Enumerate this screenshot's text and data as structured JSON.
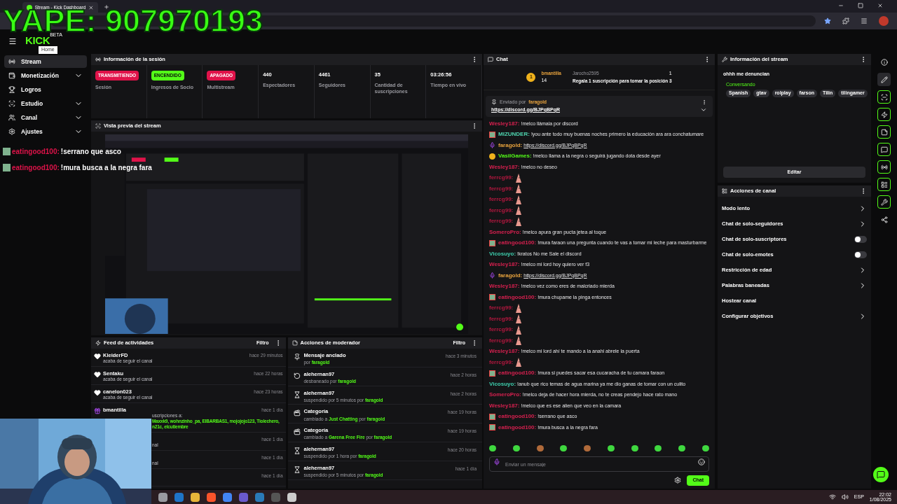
{
  "browser": {
    "tab_title": "Stream - Kick Dashboard"
  },
  "overlay": {
    "banner": "YAPE: 907970193",
    "chat_lines": [
      {
        "user": "eatingood100:",
        "text": "!serrano que asco"
      },
      {
        "user": "eatingood100:",
        "text": "!mura busca a la negra fara"
      }
    ]
  },
  "header": {
    "logo": "KICK",
    "logo_tag": "BETA",
    "tooltip": "Home"
  },
  "sidebar": {
    "items": [
      {
        "label": "Stream",
        "selected": true,
        "expandable": false
      },
      {
        "label": "Monetización",
        "selected": false,
        "expandable": true
      },
      {
        "label": "Logros",
        "selected": false,
        "expandable": false
      },
      {
        "label": "Estudio",
        "selected": false,
        "expandable": true
      },
      {
        "label": "Canal",
        "selected": false,
        "expandable": true
      },
      {
        "label": "Ajustes",
        "selected": false,
        "expandable": true
      }
    ]
  },
  "session": {
    "title": "Información de la sesión",
    "cells": [
      {
        "kind": "badge",
        "value": "TRANSMITIENDO",
        "color": "#e0134a",
        "label": "Sesión"
      },
      {
        "kind": "badge",
        "value": "ENCENDIDO",
        "color": "#53fc18",
        "label": "Ingresos de Socio"
      },
      {
        "kind": "badge",
        "value": "APAGADO",
        "color": "#e0134a",
        "label": "Multistream"
      },
      {
        "kind": "stat",
        "value": "440",
        "label": "Espectadores"
      },
      {
        "kind": "stat",
        "value": "4461",
        "label": "Seguidores"
      },
      {
        "kind": "stat",
        "value": "35",
        "label": "Cantidad de suscripciones"
      },
      {
        "kind": "stat",
        "value": "03:26:56",
        "label": "Tiempo en vivo"
      }
    ]
  },
  "preview": {
    "title": "Vista previa del stream",
    "kind": "picture"
  },
  "activity_feed": {
    "title": "Feed de actividades",
    "filter": "Filtro",
    "items": [
      {
        "kind": "follow",
        "user": "KleiderFD",
        "desc": "acaba de seguir el canal",
        "time": "hace 29 minutos",
        "covered": false
      },
      {
        "kind": "follow",
        "user": "Sentaku",
        "desc": "acaba de seguir el canal",
        "time": "hace 22 horas",
        "covered": false
      },
      {
        "kind": "follow",
        "user": "canelon023",
        "desc": "acaba de seguir el canal",
        "time": "hace 23 horas",
        "covered": false
      },
      {
        "kind": "gift",
        "user": "bmantilla",
        "desc": "uscripciones a:",
        "covered": true,
        "highlight_lines": [
          "Maxxk9, wohnzinho_pa, ElBARBAS1, mojojojo123, Tiolechero,",
          "n21c, elcutiembre"
        ],
        "time": "hace 1 día"
      },
      {
        "kind": "hidden",
        "desc": "nal",
        "covered": true,
        "time": "hace 1 día"
      },
      {
        "kind": "hidden",
        "desc": "nal",
        "covered": true,
        "time": "hace 1 día"
      },
      {
        "kind": "hidden",
        "time": "hace 1 día"
      }
    ]
  },
  "mod_actions": {
    "title": "Acciones de moderador",
    "filter": "Filtro",
    "items": [
      {
        "kind": "pin",
        "title": "Mensaje anclado",
        "parts": [
          {
            "t": "por ",
            "hl": false
          },
          {
            "t": "faragold",
            "hl": true
          }
        ],
        "time": "hace 3 minutos"
      },
      {
        "kind": "unban",
        "title": "alehernan97",
        "parts": [
          {
            "t": "desbaneado por ",
            "hl": false
          },
          {
            "t": "faragold",
            "hl": true
          }
        ],
        "time": "hace 2 horas"
      },
      {
        "kind": "timeout",
        "title": "alehernan97",
        "parts": [
          {
            "t": "suspendido por 5 minutos por ",
            "hl": false
          },
          {
            "t": "faragold",
            "hl": true
          }
        ],
        "time": "hace 2 horas"
      },
      {
        "kind": "category",
        "title": "Categoría",
        "parts": [
          {
            "t": "cambiado a ",
            "hl": false
          },
          {
            "t": "Just Chatting",
            "hl": true
          },
          {
            "t": " por ",
            "hl": false
          },
          {
            "t": "faragold",
            "hl": true
          }
        ],
        "time": "hace 19 horas"
      },
      {
        "kind": "category",
        "title": "Categoría",
        "parts": [
          {
            "t": "cambiado a ",
            "hl": false
          },
          {
            "t": "Garena Free Fire",
            "hl": true
          },
          {
            "t": " por ",
            "hl": false
          },
          {
            "t": "faragold",
            "hl": true
          }
        ],
        "time": "hace 19 horas"
      },
      {
        "kind": "timeout",
        "title": "alehernan97",
        "parts": [
          {
            "t": "suspendido por 1 hora por ",
            "hl": false
          },
          {
            "t": "faragold",
            "hl": true
          }
        ],
        "time": "hace 20 horas"
      },
      {
        "kind": "timeout",
        "title": "alehernan97",
        "parts": [
          {
            "t": "suspendido por 5 minutos por ",
            "hl": false
          },
          {
            "t": "faragold",
            "hl": true
          }
        ],
        "time": "hace 1 día"
      }
    ]
  },
  "chat": {
    "title": "Chat",
    "leaderboard": {
      "rank": "1",
      "top_user": "bmantilla",
      "top_count": "14",
      "second_user": "Jarocho2595",
      "second_count": "1",
      "prompt": "Regala 1 suscripción para tomar la posición 3"
    },
    "pinned": {
      "label": "Enviado por",
      "user": "faragold",
      "link": "https://discord.gg/BJPqBPqR"
    },
    "messages": [
      {
        "kind": "text",
        "user": "Wesley187:",
        "color": "#d6204f",
        "text": "!melco llámala por discord"
      },
      {
        "kind": "text",
        "badge": {
          "kind": "avatar"
        },
        "user": "MIZUNDER:",
        "color": "#4fd6b0",
        "text": "!you ante todo muy buenas noches primero la educación ara ara conchatumare"
      },
      {
        "kind": "link",
        "badge": {
          "kind": "mic"
        },
        "user": "faragold:",
        "color": "#e8a33d",
        "text": "https://discord.gg/BJPqBPqR"
      },
      {
        "kind": "text",
        "badge": {
          "kind": "coin"
        },
        "user": "VasilGames:",
        "color": "#53fc18",
        "text": "!melco llama a la negra o seguirá jugando dota desde ayer"
      },
      {
        "kind": "text",
        "user": "Wesley187:",
        "color": "#d6204f",
        "text": "!melco no deseo"
      },
      {
        "kind": "emote",
        "user": "ferrcg99:",
        "color": "#b5173f"
      },
      {
        "kind": "emote",
        "user": "ferrcg99:",
        "color": "#b5173f"
      },
      {
        "kind": "emote",
        "user": "ferrcg99:",
        "color": "#b5173f"
      },
      {
        "kind": "emote",
        "user": "ferrcg99:",
        "color": "#b5173f"
      },
      {
        "kind": "emote",
        "user": "ferrcg99:",
        "color": "#b5173f"
      },
      {
        "kind": "text",
        "user": "SomeroPro:",
        "color": "#d6204f",
        "text": "!melco apura gran pucta jetea al toque"
      },
      {
        "kind": "text",
        "badge": {
          "kind": "avatar"
        },
        "user": "eatingood100:",
        "color": "#d6204f",
        "text": "!mura faraon una pregunta cuando te vas a tomar mi leche para masturbarme"
      },
      {
        "kind": "text",
        "user": "Vicosuyo:",
        "color": "#3ecfae",
        "text": "!kratos No me Sale el discord"
      },
      {
        "kind": "text",
        "user": "Wesley187:",
        "color": "#d6204f",
        "text": "!melco mi lord hoy quiero ver f3"
      },
      {
        "kind": "link",
        "badge": {
          "kind": "mic"
        },
        "user": "faragold:",
        "color": "#e8a33d",
        "text": "https://discord.gg/BJPqBPqR"
      },
      {
        "kind": "text",
        "user": "Wesley187:",
        "color": "#d6204f",
        "text": "!melco vez como eres de malcriado mierda"
      },
      {
        "kind": "text",
        "badge": {
          "kind": "avatar"
        },
        "user": "eatingood100:",
        "color": "#d6204f",
        "text": "!mura chupame la pinga entonces"
      },
      {
        "kind": "emote",
        "user": "ferrcg99:",
        "color": "#b5173f"
      },
      {
        "kind": "emote",
        "user": "ferrcg99:",
        "color": "#b5173f"
      },
      {
        "kind": "emote",
        "user": "ferrcg99:",
        "color": "#b5173f"
      },
      {
        "kind": "emote",
        "user": "ferrcg99:",
        "color": "#b5173f"
      },
      {
        "kind": "text",
        "user": "Wesley187:",
        "color": "#d6204f",
        "text": "!melco mi lord ahí te mando a la anahi abrele la puerta"
      },
      {
        "kind": "emote",
        "user": "ferrcg99:",
        "color": "#b5173f"
      },
      {
        "kind": "text",
        "badge": {
          "kind": "avatar"
        },
        "user": "eatingood100:",
        "color": "#d6204f",
        "text": "!mura si puedes sacar esa cucaracha de tu camara faraon"
      },
      {
        "kind": "text",
        "user": "Vicosuyo:",
        "color": "#3ecfae",
        "text": "!anub que rico temas de agua marina ya me dio ganas de tomar con un culito"
      },
      {
        "kind": "text",
        "user": "SomeroPro:",
        "color": "#d6204f",
        "text": "!melco deja de hacer hora mierda, no te creas pendejo hace rato mano"
      },
      {
        "kind": "text",
        "user": "Wesley187:",
        "color": "#d6204f",
        "text": "!melco que es ese alien que veo en la camara"
      },
      {
        "kind": "text",
        "badge": {
          "kind": "avatar"
        },
        "user": "eatingood100:",
        "color": "#d6204f",
        "text": "!serrano que asco"
      },
      {
        "kind": "text",
        "badge": {
          "kind": "avatar"
        },
        "user": "eatingood100:",
        "color": "#d6204f",
        "text": "!mura busca a la negra fara"
      }
    ],
    "input": {
      "placeholder": "Enviar un mensaje"
    },
    "send": "Chat"
  },
  "stream_info": {
    "title": "Información del stream",
    "stream_title": "ohhh me denuncian",
    "category": "Conversando",
    "tags": [
      "Spanish",
      "gtav",
      "rolplay",
      "farson",
      "Tilin",
      "tilingamer"
    ],
    "edit": "Editar"
  },
  "channel_actions": {
    "title": "Acciones de canal",
    "items": [
      {
        "kind": "link",
        "label": "Modo lento"
      },
      {
        "kind": "link",
        "label": "Chat de solo-seguidores"
      },
      {
        "kind": "toggle",
        "label": "Chat de solo-suscriptores",
        "on": false
      },
      {
        "kind": "toggle",
        "label": "Chat de solo-emotes",
        "on": false
      },
      {
        "kind": "link",
        "label": "Restricción de edad"
      },
      {
        "kind": "link",
        "label": "Palabras baneadas"
      },
      {
        "kind": "plain",
        "label": "Hostear canal"
      },
      {
        "kind": "link",
        "label": "Configurar objetivos"
      }
    ]
  },
  "rail": {
    "items": [
      {
        "selected": false,
        "bordered": false
      },
      {
        "selected": true,
        "bordered": false
      },
      {
        "selected": false,
        "bordered": true
      },
      {
        "selected": false,
        "bordered": true
      },
      {
        "selected": false,
        "bordered": true
      },
      {
        "selected": false,
        "bordered": true
      },
      {
        "selected": false,
        "bordered": true
      },
      {
        "selected": false,
        "bordered": true
      },
      {
        "selected": false,
        "bordered": true
      },
      {
        "selected": false,
        "bordered": false
      }
    ]
  },
  "taskbar": {
    "language": "ESP",
    "time": "22:02",
    "date": "1/08/2025"
  }
}
